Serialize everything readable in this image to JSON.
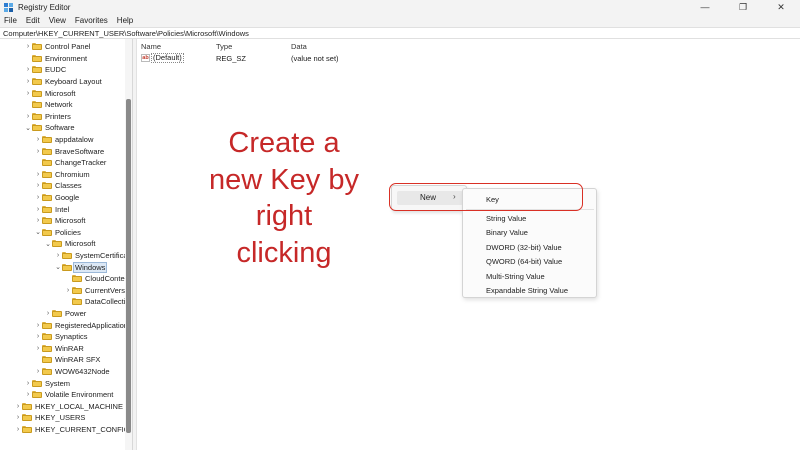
{
  "window": {
    "title": "Registry Editor",
    "controls": {
      "minimize": "—",
      "maximize": "❐",
      "close": "✕"
    }
  },
  "menu": [
    "File",
    "Edit",
    "View",
    "Favorites",
    "Help"
  ],
  "address": "Computer\\HKEY_CURRENT_USER\\Software\\Policies\\Microsoft\\Windows",
  "tree": [
    {
      "label": "Control Panel",
      "chevron": "›"
    },
    {
      "label": "Environment",
      "chevron": ""
    },
    {
      "label": "EUDC",
      "chevron": "›"
    },
    {
      "label": "Keyboard Layout",
      "chevron": "›"
    },
    {
      "label": "Microsoft",
      "chevron": "›"
    },
    {
      "label": "Network",
      "chevron": ""
    },
    {
      "label": "Printers",
      "chevron": "›"
    },
    {
      "label": "Software",
      "chevron": "⌄"
    },
    {
      "label": "appdatalow",
      "chevron": "›"
    },
    {
      "label": "BraveSoftware",
      "chevron": "›"
    },
    {
      "label": "ChangeTracker",
      "chevron": ""
    },
    {
      "label": "Chromium",
      "chevron": "›"
    },
    {
      "label": "Classes",
      "chevron": "›"
    },
    {
      "label": "Google",
      "chevron": "›"
    },
    {
      "label": "Intel",
      "chevron": "›"
    },
    {
      "label": "Microsoft",
      "chevron": "›"
    },
    {
      "label": "Policies",
      "chevron": "⌄"
    },
    {
      "label": "Microsoft",
      "chevron": "⌄"
    },
    {
      "label": "SystemCertifica",
      "chevron": "›"
    },
    {
      "label": "Windows",
      "chevron": "⌄"
    },
    {
      "label": "CloudConte",
      "chevron": ""
    },
    {
      "label": "CurrentVersi",
      "chevron": "›"
    },
    {
      "label": "DataCollecti",
      "chevron": ""
    },
    {
      "label": "Power",
      "chevron": "›"
    },
    {
      "label": "RegisteredApplication",
      "chevron": "›"
    },
    {
      "label": "Synaptics",
      "chevron": "›"
    },
    {
      "label": "WinRAR",
      "chevron": "›"
    },
    {
      "label": "WinRAR SFX",
      "chevron": ""
    },
    {
      "label": "WOW6432Node",
      "chevron": "›"
    },
    {
      "label": "System",
      "chevron": "›"
    },
    {
      "label": "Volatile Environment",
      "chevron": "›"
    },
    {
      "label": "HKEY_LOCAL_MACHINE",
      "chevron": "›"
    },
    {
      "label": "HKEY_USERS",
      "chevron": "›"
    },
    {
      "label": "HKEY_CURRENT_CONFIG",
      "chevron": "›"
    }
  ],
  "selected_tree_item": "Windows",
  "columns": {
    "name": "Name",
    "type": "Type",
    "data": "Data"
  },
  "value_row": {
    "icon": "ab",
    "name": "(Default)",
    "type": "REG_SZ",
    "data": "(value not set)"
  },
  "annotation": [
    "Create a",
    "new Key by",
    "right",
    "clicking"
  ],
  "context_menu": {
    "new_label": "New",
    "arrow": "›"
  },
  "submenu": {
    "key": "Key",
    "items": [
      "String Value",
      "Binary Value",
      "DWORD (32-bit) Value",
      "QWORD (64-bit) Value",
      "Multi-String Value",
      "Expandable String Value"
    ]
  },
  "colors": {
    "annotation": "#c62828",
    "highlight": "#d93025",
    "folder": "#f2c94c"
  }
}
